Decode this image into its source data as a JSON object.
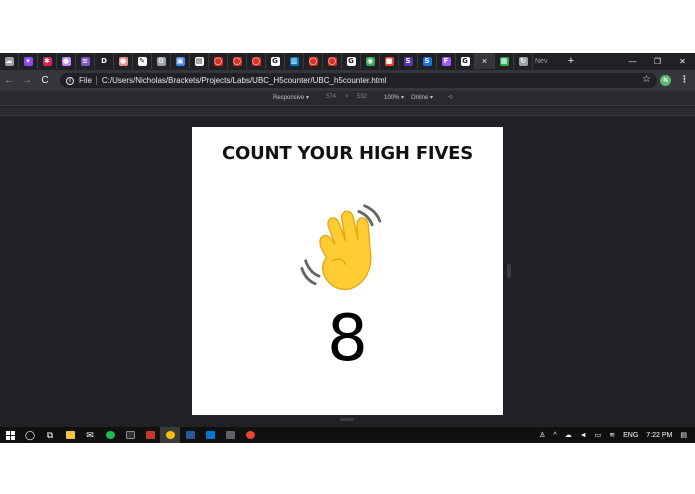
{
  "browser": {
    "tabs": [
      {
        "icon": "cloud-icon",
        "color": "#9aa0a6",
        "glyph": "☁"
      },
      {
        "icon": "twitch-icon",
        "color": "#9146ff",
        "glyph": "▾"
      },
      {
        "icon": "slack-icon",
        "color": "#e01e5a",
        "glyph": "✱"
      },
      {
        "icon": "avatar-icon",
        "color": "#c58af9",
        "glyph": "●"
      },
      {
        "icon": "list-icon",
        "color": "#7e57c2",
        "glyph": "≡"
      },
      {
        "icon": "d-icon",
        "color": "#202124",
        "glyph": "D"
      },
      {
        "icon": "avatar-icon",
        "color": "#f28b82",
        "glyph": "●"
      },
      {
        "icon": "cursor-icon",
        "color": "#ffffff",
        "glyph": "✎"
      },
      {
        "icon": "gear-icon",
        "color": "#9aa0a6",
        "glyph": "⚙"
      },
      {
        "icon": "doc-icon",
        "color": "#4285f4",
        "glyph": "▣"
      },
      {
        "icon": "doc-icon",
        "color": "#ffffff",
        "glyph": "▤"
      },
      {
        "icon": "opera-icon",
        "color": "#d93025",
        "glyph": "◯"
      },
      {
        "icon": "opera-icon",
        "color": "#d93025",
        "glyph": "◯"
      },
      {
        "icon": "opera-icon",
        "color": "#d93025",
        "glyph": "◯"
      },
      {
        "icon": "google-icon",
        "color": "#ffffff",
        "glyph": "G"
      },
      {
        "icon": "trello-icon",
        "color": "#0079bf",
        "glyph": "▥"
      },
      {
        "icon": "opera-icon",
        "color": "#d93025",
        "glyph": "◯"
      },
      {
        "icon": "opera-icon",
        "color": "#d93025",
        "glyph": "◯"
      },
      {
        "icon": "google-icon",
        "color": "#ffffff",
        "glyph": "G"
      },
      {
        "icon": "chrome-icon",
        "color": "#34a853",
        "glyph": "◉"
      },
      {
        "icon": "square-icon",
        "color": "#ea4335",
        "glyph": "■"
      },
      {
        "icon": "s-icon",
        "color": "#5e35b1",
        "glyph": "S"
      },
      {
        "icon": "s-icon",
        "color": "#1a73e8",
        "glyph": "S"
      },
      {
        "icon": "figma-icon",
        "color": "#a259ff",
        "glyph": "F"
      },
      {
        "icon": "google-icon",
        "color": "#ffffff",
        "glyph": "G"
      }
    ],
    "active_tab_close": "×",
    "extra_tabs": [
      {
        "icon": "sheet-icon",
        "color": "#34a853",
        "glyph": "▦"
      },
      {
        "icon": "refresh-icon",
        "color": "#9aa0a6",
        "glyph": "↻"
      }
    ],
    "truncated_tab_text": "Nev",
    "new_tab": "+",
    "window_controls": [
      "—",
      "❐",
      "✕"
    ],
    "back": "←",
    "forward": "→",
    "reload": "C",
    "info": "i",
    "file_label": "File",
    "url": "C:/Users/Nicholas/Brackets/Projects/Labs/UBC_H5counter/UBC_h5counter.html",
    "bookmark_star": "☆",
    "profile_initial": "N",
    "menu": "⋮"
  },
  "devtools": {
    "device": "Responsive ▾",
    "width": "574",
    "times": "×",
    "height": "532",
    "zoom": "100% ▾",
    "network": "Online ▾",
    "rotate": "⟲"
  },
  "page": {
    "title": "COUNT YOUR HIGH FIVES",
    "count": "8"
  },
  "taskbar": {
    "right_items": [
      "ENG",
      "7:22 PM"
    ]
  }
}
